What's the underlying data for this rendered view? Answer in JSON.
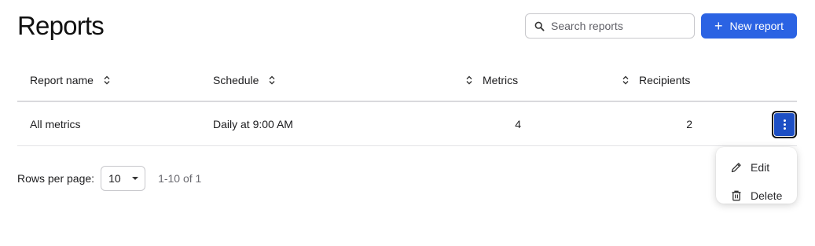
{
  "header": {
    "title": "Reports",
    "search_placeholder": "Search reports",
    "search_value": "",
    "new_button_label": "New report",
    "new_button_icon": "plus-icon"
  },
  "table": {
    "columns": [
      {
        "label": "Report name",
        "sortable": true
      },
      {
        "label": "Schedule",
        "sortable": true
      },
      {
        "label": "Metrics",
        "sortable": true
      },
      {
        "label": "Recipients",
        "sortable": true
      }
    ],
    "rows": [
      {
        "name": "All metrics",
        "schedule": "Daily at 9:00 AM",
        "metrics": "4",
        "recipients": "2"
      }
    ]
  },
  "row_menu": {
    "items": [
      {
        "label": "Edit",
        "icon": "pencil-icon"
      },
      {
        "label": "Delete",
        "icon": "trash-icon"
      }
    ]
  },
  "pagination": {
    "rows_per_page_label": "Rows per page:",
    "rows_per_page_value": "10",
    "range_text": "1-10 of 1"
  },
  "colors": {
    "accent": "#2b63e3",
    "kebab_active": "#1d4fc4"
  }
}
